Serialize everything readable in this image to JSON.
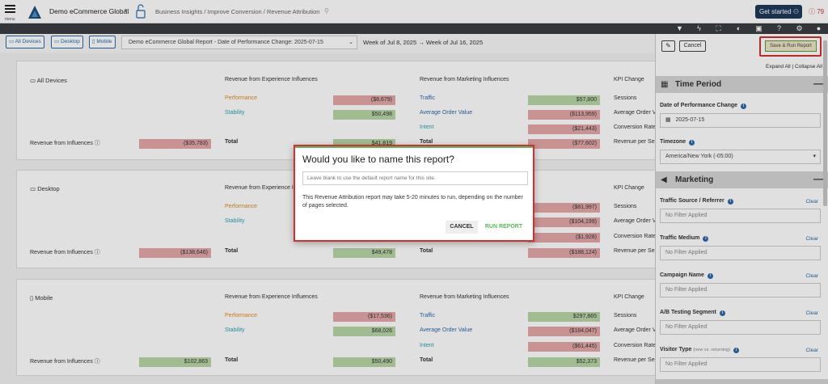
{
  "topbar": {
    "menu_label": "menu",
    "org": "Demo eCommerce Global",
    "breadcrumb": "Business Insights / Improve Conversion / Revenue Attribution",
    "get_started": "Get started",
    "alert_count": "79"
  },
  "filters": {
    "all_devices": "All Devices",
    "desktop": "Desktop",
    "mobile": "Mobile",
    "report": "Demo eCommerce Global Report - Date of Performance Change: 2025-07-15",
    "week": "Week of Jul 8, 2025 → Week of Jul 16, 2025"
  },
  "headers": {
    "exp": "Revenue from Experience Influences",
    "mkt": "Revenue from Marketing Influences",
    "kpi": "KPI Change",
    "performance": "Performance",
    "stability": "Stability",
    "traffic": "Traffic",
    "aov": "Average Order Value",
    "intent": "Intent",
    "total": "Total",
    "rev_inf": "Revenue from Influences",
    "sessions": "Sessions",
    "avg_order": "Average Order V",
    "conv": "Conversion Rate",
    "rev_per": "Revenue per Ses"
  },
  "cards": [
    {
      "title": "All Devices",
      "perf": "($8,679)",
      "stab": "$50,498",
      "exp_total": "$41,819",
      "traffic": "$57,800",
      "aov": "($113,959)",
      "intent": "($21,443)",
      "mkt_total": "($77,602)",
      "influences": "($35,783)"
    },
    {
      "title": "Desktop",
      "perf": "",
      "stab": "",
      "exp_total": "$49,478",
      "traffic": "($81,997)",
      "aov": "($104,199)",
      "intent": "($1,928)",
      "mkt_total": "($188,124)",
      "influences": "($138,646)"
    },
    {
      "title": "Mobile",
      "perf": "($17,536)",
      "stab": "$68,026",
      "exp_total": "$50,490",
      "traffic": "$297,865",
      "aov": "($184,047)",
      "intent": "($61,445)",
      "mkt_total": "$52,373",
      "influences": "$102,863"
    }
  ],
  "dialog": {
    "title": "Would you like to name this report?",
    "placeholder": "Leave blank to use the default report name for this site.",
    "message": "This Revenue Attribution report may take 5-20 minutes to run, depending on the number of pages selected.",
    "cancel": "CANCEL",
    "run": "RUN REPORT"
  },
  "panel": {
    "cancel": "Cancel",
    "save_run": "Save & Run Report",
    "expand": "Expand All | Collapse All",
    "time_period": "Time Period",
    "date_label": "Date of Performance Change",
    "date_value": "2025-07-15",
    "tz_label": "Timezone",
    "tz_value": "America/New York (-05:00)",
    "marketing": "Marketing",
    "clear": "Clear",
    "no_filter": "No Filter Applied",
    "fields": [
      "Traffic Source / Referrer",
      "Traffic Medium",
      "Campaign Name",
      "A/B Testing Segment",
      "Visitor Type"
    ],
    "visitor_sub": "(new vs. returning)"
  }
}
